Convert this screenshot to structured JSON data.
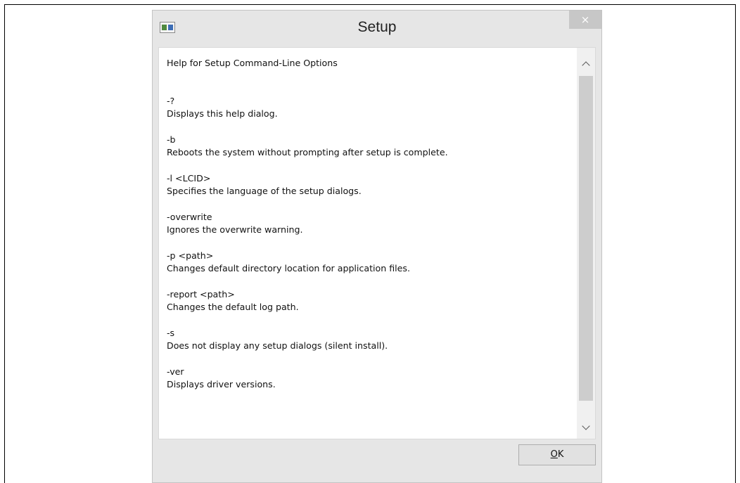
{
  "window": {
    "title": "Setup",
    "close_glyph": "×",
    "icon": "app-window-icon"
  },
  "content": {
    "heading": "Help for Setup Command-Line Options",
    "options": [
      {
        "flag": "-?",
        "description": "Displays this help dialog."
      },
      {
        "flag": "-b",
        "description": "Reboots the system without prompting after setup is complete."
      },
      {
        "flag": "-l <LCID>",
        "description": "Specifies the language of the setup dialogs."
      },
      {
        "flag": "-overwrite",
        "description": "Ignores the overwrite warning."
      },
      {
        "flag": "-p <path>",
        "description": "Changes default directory location for application files."
      },
      {
        "flag": "-report <path>",
        "description": "Changes the default log path."
      },
      {
        "flag": "-s",
        "description": "Does not display any setup dialogs (silent install)."
      },
      {
        "flag": "-ver",
        "description": "Displays driver versions."
      }
    ]
  },
  "footer": {
    "ok_mnemonic": "O",
    "ok_rest": "K"
  }
}
